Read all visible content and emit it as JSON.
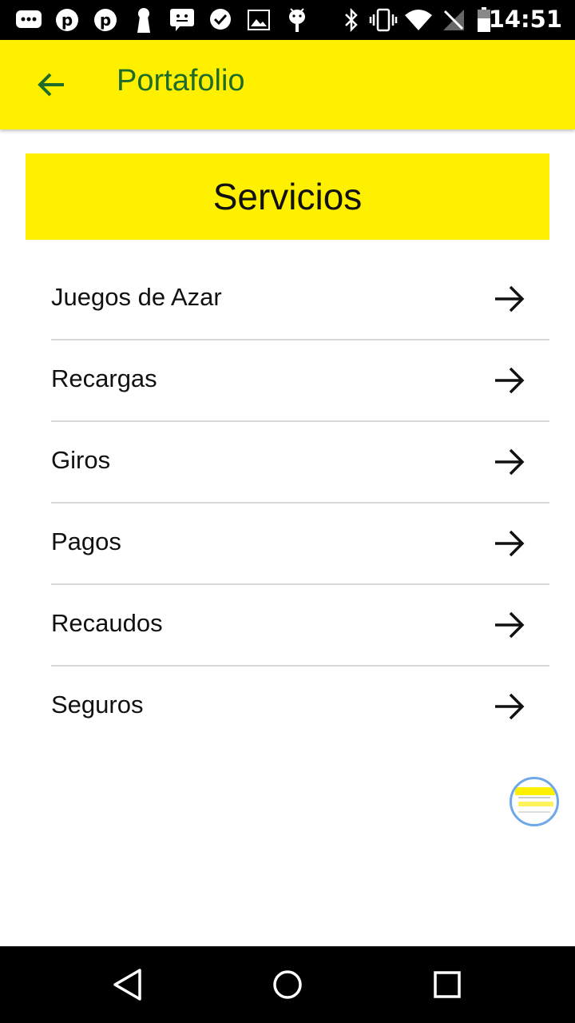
{
  "status_bar": {
    "time": "14:51",
    "left_icons": [
      "message-icon",
      "pinterest-icon",
      "pinterest-icon",
      "keyhole-icon",
      "chat-bubble-icon",
      "heart-chat-icon",
      "image-icon",
      "android-icon"
    ],
    "right_icons": [
      "bluetooth-icon",
      "vibrate-icon",
      "wifi-icon",
      "no-signal-icon",
      "battery-icon"
    ]
  },
  "app_bar": {
    "title": "Portafolio",
    "back_icon": "arrow-left-icon",
    "background_color": "#fff000",
    "title_color": "#1e6b2a"
  },
  "section": {
    "title": "Servicios"
  },
  "services": [
    {
      "label": "Juegos de Azar",
      "icon": "arrow-right-icon"
    },
    {
      "label": "Recargas",
      "icon": "arrow-right-icon"
    },
    {
      "label": "Giros",
      "icon": "arrow-right-icon"
    },
    {
      "label": "Pagos",
      "icon": "arrow-right-icon"
    },
    {
      "label": "Recaudos",
      "icon": "arrow-right-icon"
    },
    {
      "label": "Seguros",
      "icon": "arrow-right-icon"
    }
  ],
  "nav_bar": {
    "buttons": [
      "back-triangle-icon",
      "home-circle-icon",
      "recents-square-icon"
    ]
  }
}
